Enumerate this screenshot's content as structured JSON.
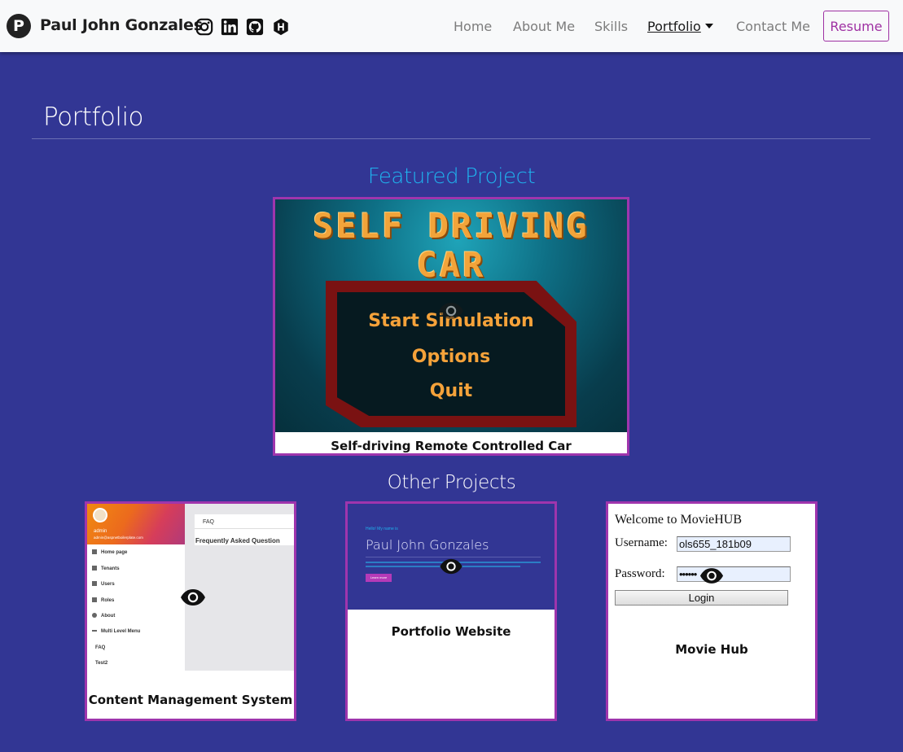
{
  "navbar": {
    "logo_letter": "P",
    "brand": "Paul John Gonzales",
    "social_icons": [
      "instagram-icon",
      "linkedin-icon",
      "github-icon",
      "hackerrank-icon"
    ],
    "links": [
      "Home",
      "About Me",
      "Skills",
      "Portfolio",
      "Contact Me"
    ],
    "active": "Portfolio",
    "resume_label": "Resume"
  },
  "page": {
    "title": "Portfolio",
    "featured_heading": "Featured Project",
    "other_heading": "Other Projects"
  },
  "featured": {
    "caption": "Self-driving Remote Controlled Car",
    "image": {
      "title_line1": "SELF DRIVING",
      "title_line2": "CAR",
      "menu": [
        "Start Simulation",
        "Options",
        "Quit"
      ]
    }
  },
  "projects": [
    {
      "caption": "Content Management System",
      "image": {
        "user_name": "admin",
        "user_email": "admin@aspnetboilerplate.com",
        "nav": [
          "Home page",
          "Tenants",
          "Users",
          "Roles",
          "About",
          "Multi Level Menu",
          "FAQ",
          "Test2"
        ],
        "page_title": "FAQ",
        "page_heading": "Frequently Asked Question"
      }
    },
    {
      "caption": "Portfolio Website",
      "image": {
        "greeting": "Hello! My name is",
        "name": "Paul John Gonzales",
        "button": "Learn more"
      }
    },
    {
      "caption": "Movie Hub",
      "image": {
        "welcome": "Welcome to MovieHUB",
        "username_label": "Username:",
        "username_value": "ols655_181b09",
        "password_label": "Password:",
        "password_value": "••••••",
        "login_button": "Login"
      }
    }
  ],
  "colors": {
    "background": "#323694",
    "accent": "#9f31a3",
    "featured_heading": "#1fb3ee"
  }
}
